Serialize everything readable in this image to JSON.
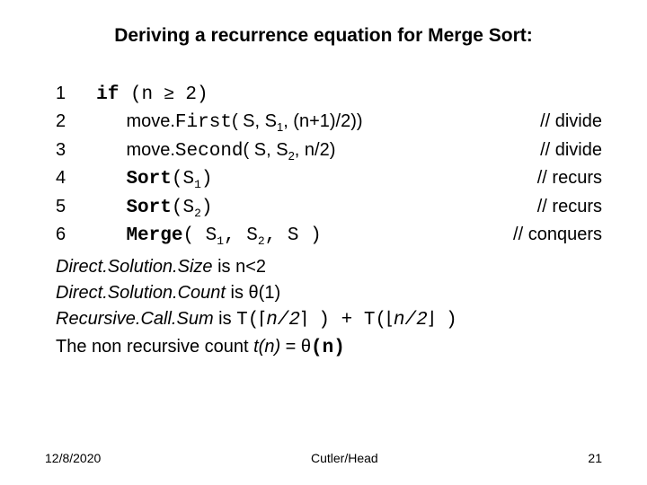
{
  "title": "Deriving a recurrence equation for Merge Sort:",
  "lines": {
    "l1": {
      "n": "1",
      "kw": "if",
      "rest1": " (n ",
      "sym": "≥",
      "rest2": " 2)"
    },
    "l2": {
      "n": "2",
      "pre": "move.",
      "fn": "First",
      "args1": "( S, S",
      "sub": "1",
      "args2": ", (n+1)/2)) ",
      "cmt": "// divide"
    },
    "l3": {
      "n": "3",
      "pre": "move.",
      "fn": "Second",
      "args1": "( S, S",
      "sub": "2",
      "args2": ", n/2)",
      "cmt": "// divide"
    },
    "l4": {
      "n": "4",
      "fn": "Sort",
      "args1": "(S",
      "sub": "1",
      "args2": ")",
      "cmt": "// recurs"
    },
    "l5": {
      "n": "5",
      "fn": "Sort",
      "args1": "(S",
      "sub": "2",
      "args2": ")",
      "cmt": "// recurs"
    },
    "l6": {
      "n": "6",
      "fn": "Merge",
      "args1": "( S",
      "sub1": "1",
      "args2": ", S",
      "sub2": "2",
      "args3": ", S )",
      "cmt": "// conquers"
    }
  },
  "prose": {
    "p1a": "Direct.Solution.Size",
    "p1b": " is n<2",
    "p2a": "Direct.Solution.Count",
    "p2b": " is θ(1)",
    "p3a": "Recursive.Call.Sum",
    "p3b": " is ",
    "p3c": "T(",
    "p3d": "⌈",
    "p3e": "n/2",
    "p3f": "⌉",
    "p3g": " ) + T(",
    "p3h": "⌊",
    "p3i": "n/2",
    "p3j": "⌋",
    "p3k": " )",
    "p4a": "The non recursive count ",
    "p4b": "t(n)",
    "p4c": " = θ",
    "p4d": "(n)"
  },
  "footer": {
    "date": "12/8/2020",
    "center": "Cutler/Head",
    "page": "21"
  }
}
